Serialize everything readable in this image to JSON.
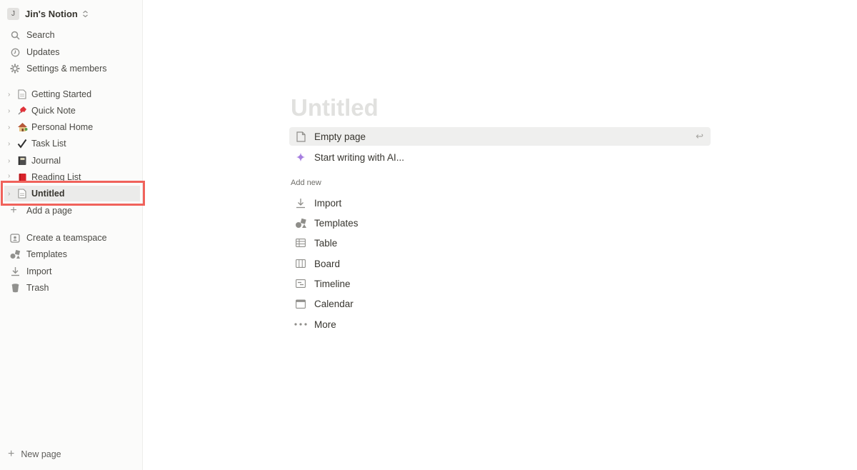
{
  "workspace": {
    "avatar": "J",
    "name": "Jin's Notion",
    "switch_icon": "chevron-up-down-icon"
  },
  "sidebar": {
    "nav": [
      {
        "label": "Search",
        "icon": "search-icon"
      },
      {
        "label": "Updates",
        "icon": "clock-icon"
      },
      {
        "label": "Settings & members",
        "icon": "gear-icon"
      }
    ],
    "pages": [
      {
        "label": "Getting Started",
        "icon": "page-icon"
      },
      {
        "label": "Quick Note",
        "icon": "pushpin-icon"
      },
      {
        "label": "Personal Home",
        "icon": "house-icon"
      },
      {
        "label": "Task List",
        "icon": "checkmark-icon"
      },
      {
        "label": "Journal",
        "icon": "notebook-icon"
      },
      {
        "label": "Reading List",
        "icon": "red-book-icon"
      },
      {
        "label": "Untitled",
        "icon": "page-icon"
      }
    ],
    "add_page": "Add a page",
    "tools": [
      {
        "label": "Create a teamspace",
        "icon": "teamspace-icon"
      },
      {
        "label": "Templates",
        "icon": "shapes-icon"
      },
      {
        "label": "Import",
        "icon": "download-icon"
      },
      {
        "label": "Trash",
        "icon": "trash-icon"
      }
    ],
    "new_page": "New page"
  },
  "main": {
    "title": "Untitled",
    "options": [
      {
        "label": "Empty page",
        "icon": "page-icon"
      },
      {
        "label": "Start writing with AI...",
        "icon": "sparkle-icon"
      }
    ],
    "add_new_label": "Add new",
    "add_new": [
      {
        "label": "Import",
        "icon": "download-icon"
      },
      {
        "label": "Templates",
        "icon": "shapes-icon"
      },
      {
        "label": "Table",
        "icon": "table-icon"
      },
      {
        "label": "Board",
        "icon": "board-icon"
      },
      {
        "label": "Timeline",
        "icon": "timeline-icon"
      },
      {
        "label": "Calendar",
        "icon": "calendar-icon"
      },
      {
        "label": "More",
        "icon": "ellipsis-icon"
      }
    ]
  },
  "colors": {
    "highlight_border": "#f0625b",
    "sidebar_bg": "#fbfbfa",
    "title_placeholder": "#e1e1df"
  }
}
